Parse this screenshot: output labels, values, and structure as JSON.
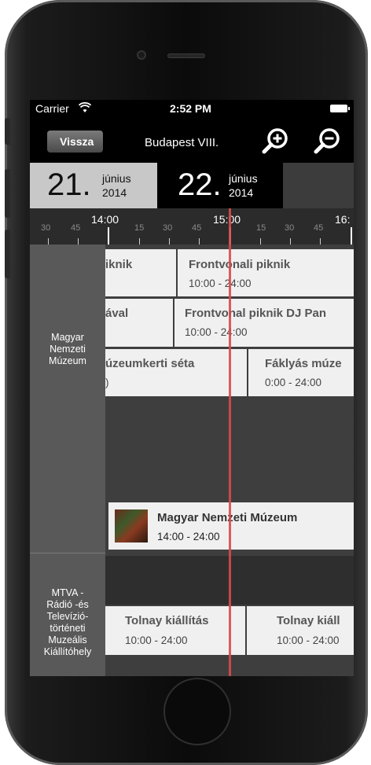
{
  "status_bar": {
    "carrier": "Carrier",
    "time": "2:52 PM"
  },
  "nav": {
    "back_label": "Vissza",
    "title": "Budapest VIII."
  },
  "dates": [
    {
      "day": "21",
      "month": "június",
      "year": "2014",
      "selected": true
    },
    {
      "day": "22",
      "month": "június",
      "year": "2014",
      "selected": false
    }
  ],
  "ruler": {
    "minor_labels": [
      "30",
      "45",
      "15",
      "30",
      "45",
      "15",
      "30",
      "45"
    ],
    "hour_labels": [
      "14:00",
      "15:00",
      "16:"
    ]
  },
  "venues": [
    {
      "name_lines": [
        "Magyar",
        "Nemzeti",
        "Múzeum"
      ]
    },
    {
      "name_lines": [
        "MTVA -",
        "Rádió -és",
        "Televízió-",
        "történeti",
        "Muzeális",
        "Kiállítóhely"
      ]
    }
  ],
  "events": [
    {
      "title": "iknik",
      "time": ""
    },
    {
      "title": "Frontvonali piknik",
      "time": "10:00 - 24:00"
    },
    {
      "title": "ával",
      "time": ""
    },
    {
      "title": "Frontvonal piknik DJ Pan",
      "time": "10:00 - 24:00"
    },
    {
      "title": "úzeumkerti séta",
      "time": ")"
    },
    {
      "title": "Fáklyás múze",
      "time": "0:00 - 24:00"
    },
    {
      "title": "Magyar Nemzeti Múzeum",
      "time": "14:00 - 24:00"
    },
    {
      "title": "Tolnay kiállítás",
      "time": "10:00 - 24:00"
    },
    {
      "title": "Tolnay kiáll",
      "time": "10:00 - 24:00"
    }
  ],
  "colors": {
    "now_line": "#d94a4a",
    "selected_date_bg": "#c8c8c8",
    "event_bg": "#f0f0f0"
  }
}
